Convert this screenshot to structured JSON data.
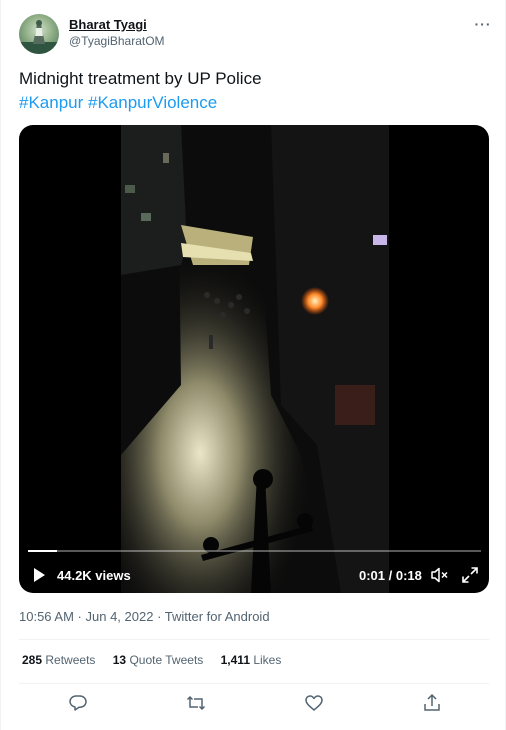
{
  "author": {
    "display_name": "Bharat Tyagi",
    "handle": "@TyagiBharatOM",
    "avatar_icon": "avatar-image"
  },
  "tweet": {
    "text": "Midnight treatment by UP Police",
    "hashtags": [
      "#Kanpur",
      "#KanpurViolence"
    ]
  },
  "video": {
    "views": "44.2K views",
    "time": "0:01 / 0:18",
    "progress_fraction": 0.065,
    "icons": [
      "play-icon",
      "mute-icon",
      "fullscreen-icon"
    ]
  },
  "meta": {
    "time": "10:56 AM",
    "date": "Jun 4, 2022",
    "source": "Twitter for Android",
    "separator": " · "
  },
  "stats": {
    "retweets_count": "285",
    "retweets_label": "Retweets",
    "quotes_count": "13",
    "quotes_label": "Quote Tweets",
    "likes_count": "1,411",
    "likes_label": "Likes"
  },
  "actions": [
    "reply-icon",
    "retweet-icon",
    "like-icon",
    "share-icon"
  ],
  "colors": {
    "link": "#1d9bf0",
    "secondary_text": "#536471",
    "primary_text": "#0f1419",
    "divider": "#eff3f4"
  }
}
